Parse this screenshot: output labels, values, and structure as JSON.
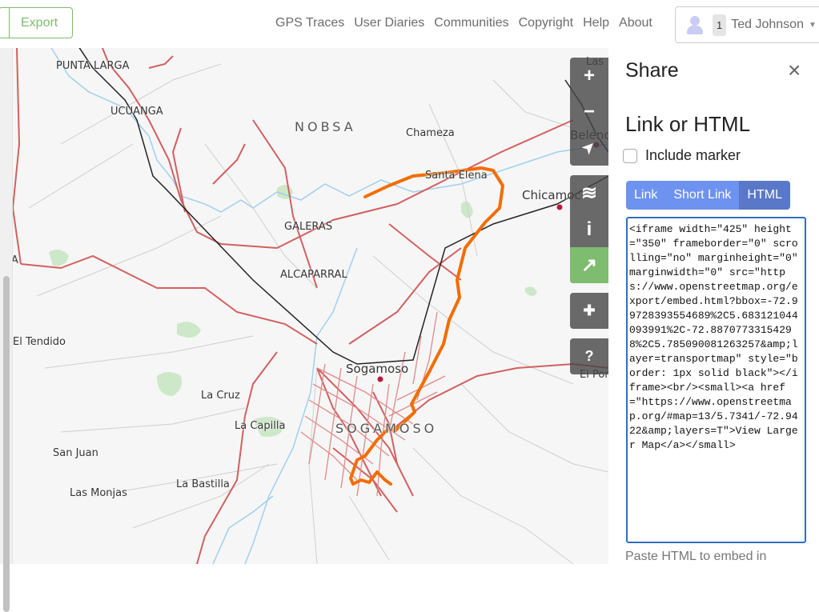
{
  "header": {
    "export_label": "Export",
    "nav": [
      "GPS Traces",
      "User Diaries",
      "Communities",
      "Copyright",
      "Help",
      "About"
    ],
    "user": {
      "badge_count": "1",
      "name": "Ted Johnson"
    }
  },
  "map": {
    "labels": {
      "punta_larga": "PUNTA LARGA",
      "ucuanga": "UCUANGA",
      "nobsa": "NOBSA",
      "chameza": "Chameza",
      "santa_elena": "Santa Elena",
      "chicamocha": "Chicamoc",
      "belencito": "Belenc",
      "las": "Las",
      "galeras": "GALERAS",
      "alcaparral": "ALCAPARRAL",
      "el_tendido": "El Tendido",
      "sogamoso_city": "Sogamoso",
      "sogamoso_area": "SOGAMOSO",
      "la_cruz": "La Cruz",
      "la_capilla": "La Capilla",
      "san_juan": "San Juan",
      "las_monjas": "Las Monjas",
      "la_bastilla": "La Bastilla",
      "el_por": "El Por",
      "a_edge": "A"
    },
    "colors": {
      "route": "#f26d00",
      "road": "#d26060",
      "rail": "#222222",
      "water": "#9fd0ee",
      "green": "#cde8c8"
    },
    "controls": [
      {
        "name": "zoom-in",
        "icon": "+"
      },
      {
        "name": "zoom-out",
        "icon": "−"
      },
      {
        "name": "locate",
        "icon": "➤"
      },
      {
        "name": "layers",
        "icon": "≋"
      },
      {
        "name": "info",
        "icon": "i"
      },
      {
        "name": "share",
        "icon": "↗"
      },
      {
        "name": "add-note",
        "icon": "✚"
      },
      {
        "name": "query",
        "icon": "?"
      }
    ]
  },
  "sidebar": {
    "title": "Share",
    "close_icon": "×",
    "subtitle": "Link or HTML",
    "include_marker_label": "Include marker",
    "include_marker_checked": false,
    "tabs": [
      {
        "label": "Link",
        "active": false
      },
      {
        "label": "Short Link",
        "active": false
      },
      {
        "label": "HTML",
        "active": true
      }
    ],
    "embed_code": "<iframe width=\"425\" height=\"350\" frameborder=\"0\" scrolling=\"no\" marginheight=\"0\" marginwidth=\"0\" src=\"https://www.openstreetmap.org/export/embed.html?bbox=-72.99728393554689%2C5.683121044093991%2C-72.88707733154298%2C5.785090081263257&amp;layer=transportmap\" style=\"border: 1px solid black\"></iframe><br/><small><a href=\"https://www.openstreetmap.org/#map=13/5.7341/-72.9422&amp;layers=T\">View Larger Map</a></small>",
    "help_text": "Paste HTML to embed in"
  }
}
